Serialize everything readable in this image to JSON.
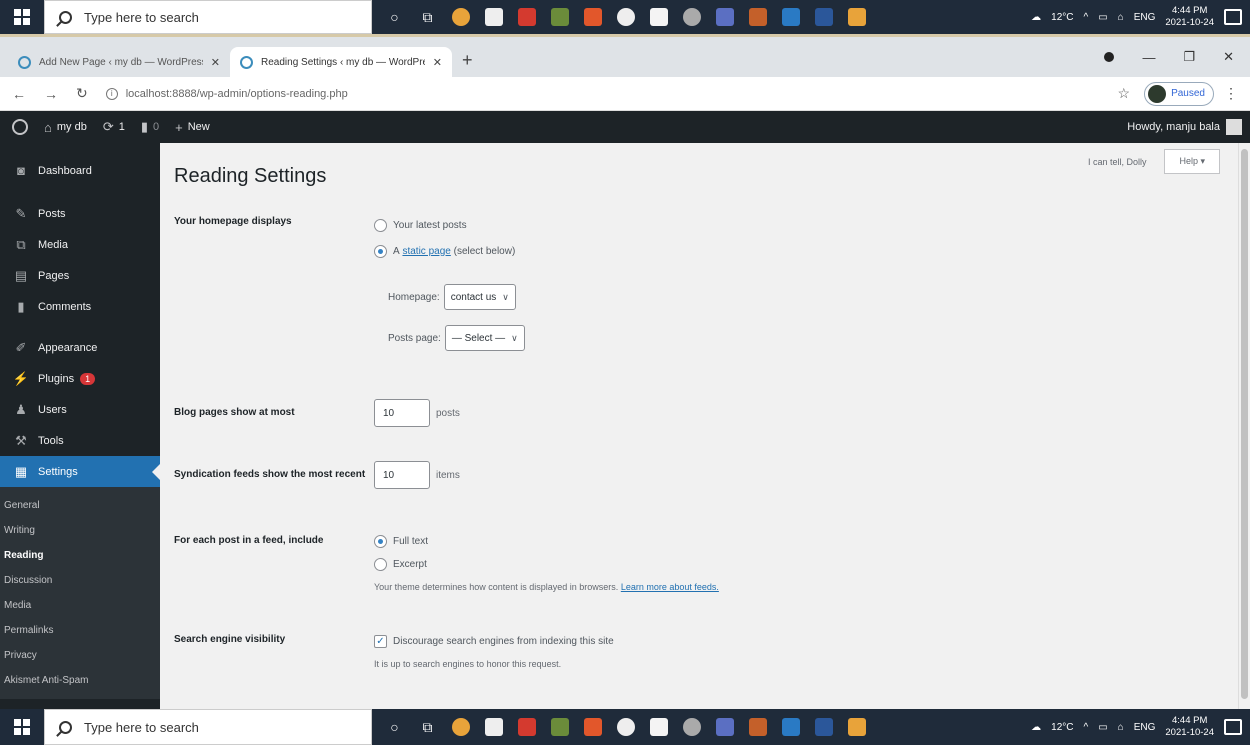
{
  "taskbar": {
    "search_placeholder": "Type here to search",
    "weather": "12°C",
    "lang": "ENG",
    "time": "4:44 PM",
    "date": "2021-10-24"
  },
  "browser": {
    "tabs": [
      {
        "title": "Add New Page ‹ my db — WordPress"
      },
      {
        "title": "Reading Settings ‹ my db — WordPress"
      }
    ],
    "url": "localhost:8888/wp-admin/options-reading.php",
    "profile_status": "Paused"
  },
  "adminbar": {
    "site_name": "my db",
    "updates_count": "1",
    "comments_count": "0",
    "new_label": "New",
    "howdy": "Howdy, manju bala"
  },
  "sidebar": {
    "items": [
      {
        "label": "Dashboard",
        "icon": "dashboard-icon"
      },
      {
        "label": "Posts",
        "icon": "pin-icon"
      },
      {
        "label": "Media",
        "icon": "media-icon"
      },
      {
        "label": "Pages",
        "icon": "pages-icon"
      },
      {
        "label": "Comments",
        "icon": "comment-icon"
      },
      {
        "label": "Appearance",
        "icon": "brush-icon"
      },
      {
        "label": "Plugins",
        "icon": "plugin-icon",
        "badge": "1"
      },
      {
        "label": "Users",
        "icon": "users-icon"
      },
      {
        "label": "Tools",
        "icon": "wrench-icon"
      },
      {
        "label": "Settings",
        "icon": "settings-icon"
      }
    ],
    "submenu": [
      "General",
      "Writing",
      "Reading",
      "Discussion",
      "Media",
      "Permalinks",
      "Privacy",
      "Akismet Anti-Spam"
    ]
  },
  "header": {
    "dolly_text": "I can tell, Dolly",
    "help_label": "Help ▾"
  },
  "page": {
    "title": "Reading Settings",
    "homepage_displays": {
      "label": "Your homepage displays",
      "option_latest": "Your latest posts",
      "option_static_prefix": "A",
      "option_static_link": "static page",
      "option_static_suffix": "(select below)",
      "homepage_label": "Homepage:",
      "homepage_value": "contact us",
      "posts_page_label": "Posts page:",
      "posts_page_value": "— Select —"
    },
    "blog_pages": {
      "label": "Blog pages show at most",
      "value": "10",
      "unit": "posts"
    },
    "syndication": {
      "label": "Syndication feeds show the most recent",
      "value": "10",
      "unit": "items"
    },
    "feed_include": {
      "label": "For each post in a feed, include",
      "option_full": "Full text",
      "option_excerpt": "Excerpt",
      "desc": "Your theme determines how content is displayed in browsers.",
      "desc_link": "Learn more about feeds."
    },
    "search_visibility": {
      "label": "Search engine visibility",
      "checkbox_label": "Discourage search engines from indexing this site",
      "desc": "It is up to search engines to honor this request."
    }
  },
  "colors": {
    "accent": "#2271b1",
    "adminbar": "#1d2327",
    "plugin_badge": "#d63638"
  }
}
